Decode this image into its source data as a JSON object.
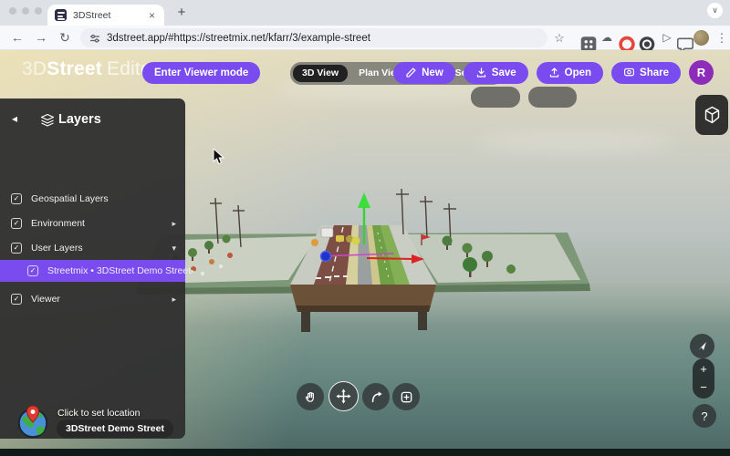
{
  "browser": {
    "tab_title": "3DStreet",
    "url": "3dstreet.app/#https://streetmix.net/kfarr/3/example-street"
  },
  "icons": {
    "back": "←",
    "forward": "→",
    "refresh": "↻",
    "star": "☆",
    "cloud": "☁",
    "play": "▷",
    "menu": "⋮",
    "close_tab": "×",
    "new_tab": "+",
    "window_chevron": "∨",
    "panel_back": "◂",
    "chevron_right": "▸",
    "chevron_down": "▾",
    "check": "✓"
  },
  "header": {
    "logo_3d": "3D",
    "logo_street": "Street",
    "logo_editor": "Editor",
    "enter_viewer_button": "Enter Viewer mode",
    "tab_3d_view": "3D View",
    "tab_plan_view": "Plan View",
    "tab_cross_section": "Cross Section",
    "action_new": "New",
    "action_save": "Save",
    "action_open": "Open",
    "action_share": "Share",
    "avatar_initial": "R"
  },
  "layers_panel": {
    "title": "Layers",
    "items": [
      {
        "label": "Geospatial Layers"
      },
      {
        "label": "Environment"
      },
      {
        "label": "User Layers"
      },
      {
        "label": "Streetmix • 3DStreet Demo Street"
      },
      {
        "label": "Viewer"
      }
    ]
  },
  "location": {
    "hint": "Click to set location",
    "street_name": "3DStreet Demo Street"
  },
  "view_controls": {
    "zoom_in": "+",
    "zoom_out": "−",
    "help": "?"
  },
  "colors": {
    "accent_purple": "#7a4cf0",
    "avatar_purple": "#8e2cba",
    "panel_bg": "#303030",
    "scene_green": "#7d9877",
    "road_brown": "#7d4f44"
  }
}
